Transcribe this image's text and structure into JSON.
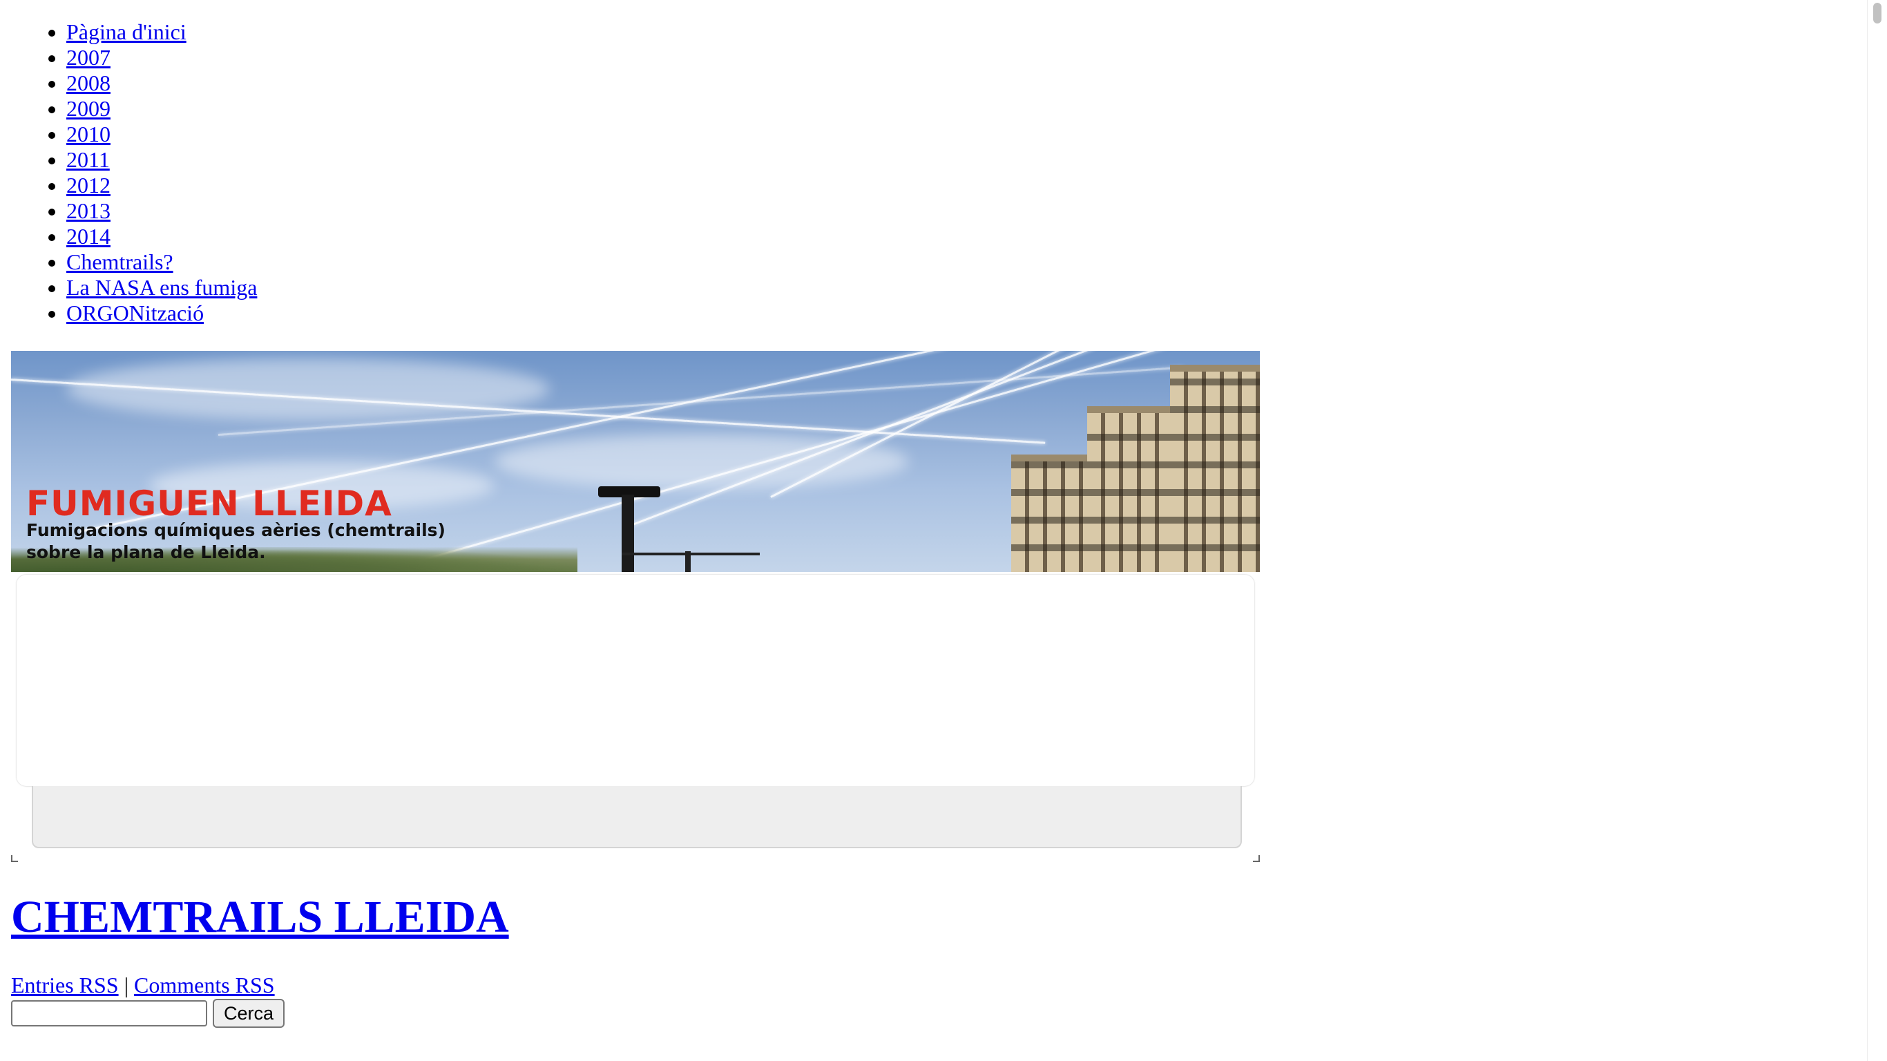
{
  "nav": {
    "items": [
      {
        "label": "Pàgina d'inici"
      },
      {
        "label": "2007"
      },
      {
        "label": "2008"
      },
      {
        "label": "2009"
      },
      {
        "label": "2010"
      },
      {
        "label": "2011"
      },
      {
        "label": "2012"
      },
      {
        "label": "2013"
      },
      {
        "label": "2014"
      },
      {
        "label": "Chemtrails?"
      },
      {
        "label": "La NASA ens fumiga"
      },
      {
        "label": "ORGONització"
      }
    ]
  },
  "banner": {
    "title": "FUMIGUEN LLEIDA",
    "subtitle_line1": "Fumigacions químiques aèries (chemtrails)",
    "subtitle_line2": "sobre la plana de Lleida.",
    "title_color": "#e02b20"
  },
  "site": {
    "title": "CHEMTRAILS LLEIDA"
  },
  "feeds": {
    "entries_label": "Entries RSS",
    "separator": "|",
    "comments_label": "Comments RSS"
  },
  "search": {
    "value": "",
    "button_label": "Cerca"
  },
  "colors": {
    "link": "#0000ee",
    "page_background": "#ffffff"
  }
}
